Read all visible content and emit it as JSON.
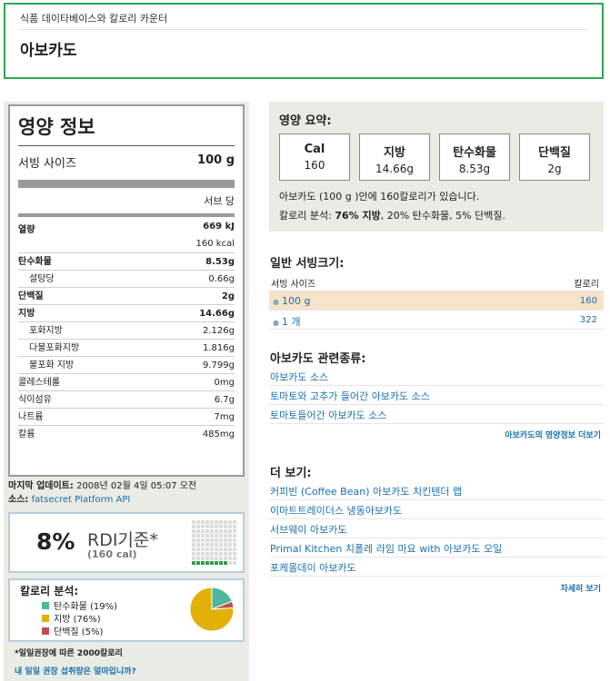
{
  "header": {
    "breadcrumb": "식품 데이타베이스와 칼로리 카운터",
    "title": "아보카도"
  },
  "nutrition": {
    "title": "영양 정보",
    "serving_label": "서빙 사이즈",
    "serving_value": "100 g",
    "per_serving": "서브 당",
    "energy_label": "열량",
    "energy_kj": "669 kJ",
    "energy_kcal": "160 kcal",
    "rows": [
      {
        "label": "탄수화물",
        "value": "8.53g"
      },
      {
        "label": "설탕당",
        "value": "0.66g"
      },
      {
        "label": "단백질",
        "value": "2g"
      },
      {
        "label": "지방",
        "value": "14.66g"
      },
      {
        "label": "포화지방",
        "value": "2.126g"
      },
      {
        "label": "다불포화지방",
        "value": "1.816g"
      },
      {
        "label": "불포화 지방",
        "value": "9.799g"
      },
      {
        "label": "콜레스테롤",
        "value": "0mg"
      },
      {
        "label": "식이섬유",
        "value": "6.7g"
      },
      {
        "label": "나트륨",
        "value": "7mg"
      },
      {
        "label": "칼륨",
        "value": "485mg"
      }
    ]
  },
  "meta": {
    "updated_label": "마지막 업데이트:",
    "updated_value": "2008년 02월 4일 05:07 오전",
    "source_label": "소스:",
    "source_link": "fatsecret Platform API"
  },
  "rdi": {
    "percent": "8%",
    "label": "RDI기준*",
    "calories": "(160 cal)",
    "fraction": 0.08
  },
  "calorie_breakdown": {
    "title": "칼로리 분석:",
    "items": [
      {
        "label": "탄수화물 (19%)",
        "percent": 19,
        "color": "#4db79a"
      },
      {
        "label": "지방 (76%)",
        "percent": 76,
        "color": "#e2b007"
      },
      {
        "label": "단백질 (5%)",
        "percent": 5,
        "color": "#c0504d"
      }
    ]
  },
  "footnote": "*일일권장에 따른 2000칼로리",
  "ask_link": "내 일일 권장 섭취량은 얼마입니까?",
  "summary": {
    "title": "영양 요약:",
    "boxes": [
      {
        "label": "Cal",
        "value": "160"
      },
      {
        "label": "지방",
        "value": "14.66g"
      },
      {
        "label": "탄수화물",
        "value": "8.53g"
      },
      {
        "label": "단백질",
        "value": "2g"
      }
    ],
    "line1": "아보카도 (100 g )안에 160칼로리가 있습니다.",
    "line2_prefix": "칼로리 분석: ",
    "line2_bold": "76% 지방",
    "line2_suffix": ", 20% 탄수화물, 5% 단백질."
  },
  "servings": {
    "title": "일반 서빙크기:",
    "col_size": "서빙 사이즈",
    "col_cal": "칼로리",
    "rows": [
      {
        "size": "100 g",
        "cal": "160"
      },
      {
        "size": "1 개",
        "cal": "322"
      }
    ]
  },
  "related": {
    "title": "아보카도 관련종류:",
    "items": [
      "아보카도 소스",
      "토마토와 고추가 들어간 아보카도 소스",
      "토마토들어간 아보카도 소스"
    ],
    "more": "아보카도의 영양정보 더보기"
  },
  "see_more": {
    "title": "더 보기:",
    "items": [
      "커피빈 (Coffee Bean) 아보카도 치킨텐더 랩",
      "이마트트레이더스 냉동아보카도",
      "서브웨이 아보카도",
      "Primal Kitchen 치폴레 라임 마요 with 아보카도 오일",
      "포케올데이 아보카도"
    ],
    "more": "자세히 보기"
  }
}
